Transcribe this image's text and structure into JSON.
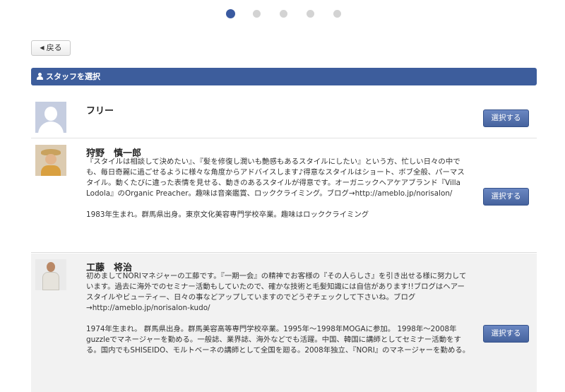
{
  "pager": {
    "count": 5,
    "active_index": 0,
    "active_color": "#3a5aa0",
    "inactive_color": "#d3d3d3"
  },
  "back_button": {
    "label": "戻る",
    "icon": "left-triangle-icon"
  },
  "header": {
    "title": "スタッフを選択",
    "icon": "user-icon",
    "color": "#3d5d9c"
  },
  "staff": [
    {
      "name": "フリー",
      "avatar": "default-avatar-icon",
      "bio": [],
      "select_label": "選択する"
    },
    {
      "name": "狩野　慎一郎",
      "avatar": "staff-photo",
      "bio": [
        "『スタイルは相談して決めたい』、『髪を修復し潤いも艶感もあるスタイルにしたい』という方、忙しい日々の中でも、毎日奇麗に過ごせるように様々な角度からアドバイスします♪得意なスタイルはショート、ボブ全般、パーマスタイル。動くたびに違った表情を見せる、動きのあるスタイルが得意です。オーガニックヘアケアブランド『Villa Lodola』のOrganic Preacher。趣味は音楽鑑賞、ロッククライミング。ブログ→http://ameblo.jp/norisalon/",
        "1983年生まれ。群馬県出身。東京文化美容専門学校卒業。趣味はロッククライミング"
      ],
      "select_label": "選択する"
    },
    {
      "name": "工藤　将治",
      "avatar": "staff-photo",
      "bio": [
        "初めましてNORIマネジャーの工藤です。『一期一会』の精神でお客様の『その人らしさ』を引き出せる様に努力しています。過去に海外でのセミナー活動もしていたので、確かな技術と毛髪知識には自信があります!!ブログはヘアースタイルやビューティー、日々の事などアップしていますのでどうぞチェックして下さいね。ブログ→http://ameblo.jp/norisalon-kudo/",
        "1974年生まれ。 群馬県出身。群馬美容高等専門学校卒業。1995年〜1998年MOGAに参加。 1998年〜2008年guzzleでマネージャーを勤める。一般誌、業界誌、海外などでも活躍。中国、韓国に講師としてセミナー活動をする。国内でもSHISEIDO、モルトベーネの講師として全国を廻る。2008年独立、『NORI』のマネージャーを勤める。"
      ],
      "select_label": "選択する"
    }
  ]
}
